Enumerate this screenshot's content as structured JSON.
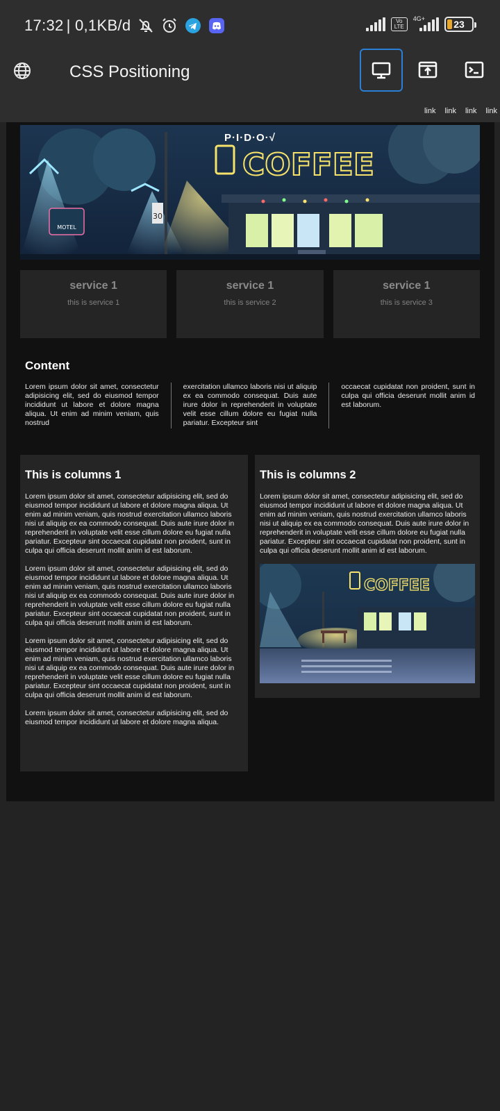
{
  "status_bar": {
    "time": "17:32",
    "net_speed": "| 0,1KB/d",
    "volte": "Vo LTE",
    "network": "4G+",
    "battery": "23",
    "icons": [
      "bell-off-icon",
      "alarm-icon",
      "telegram-icon",
      "discord-icon",
      "signal-icon",
      "battery-icon"
    ]
  },
  "app_bar": {
    "title": "CSS Positioning",
    "buttons": [
      "desktop-preview",
      "open-external",
      "console"
    ],
    "links": [
      "link",
      "link",
      "link",
      "link"
    ]
  },
  "hero": {
    "brand": "P·I·D·O·√",
    "sign_text": "COFFEE",
    "motel_text": "MOTEL",
    "speed_sign": "30"
  },
  "services": [
    {
      "title": "service 1",
      "desc": "this is service 1"
    },
    {
      "title": "service 1",
      "desc": "this is service 2"
    },
    {
      "title": "service 1",
      "desc": "this is service 3"
    }
  ],
  "content": {
    "title": "Content",
    "columns": [
      "Lorem ipsum dolor sit amet, consectetur adipisicing elit, sed do eiusmod tempor incididunt ut labore et dolore magna aliqua. Ut enim ad minim veniam, quis nostrud",
      "exercitation ullamco laboris nisi ut aliquip ex ea commodo consequat. Duis aute irure dolor in reprehenderit in voluptate velit esse cillum dolore eu fugiat nulla pariatur. Excepteur sint",
      "occaecat cupidatat non proident, sunt in culpa qui officia deserunt mollit anim id est laborum."
    ]
  },
  "columns1": {
    "title": "This is columns 1",
    "paragraphs": [
      "Lorem ipsum dolor sit amet, consectetur adipisicing elit, sed do eiusmod tempor incididunt ut labore et dolore magna aliqua. Ut enim ad minim veniam, quis nostrud exercitation ullamco laboris nisi ut aliquip ex ea commodo consequat. Duis aute irure dolor in reprehenderit in voluptate velit esse cillum dolore eu fugiat nulla pariatur. Excepteur sint occaecat cupidatat non proident, sunt in culpa qui officia deserunt mollit anim id est laborum.",
      "Lorem ipsum dolor sit amet, consectetur adipisicing elit, sed do eiusmod tempor incididunt ut labore et dolore magna aliqua. Ut enim ad minim veniam, quis nostrud exercitation ullamco laboris nisi ut aliquip ex ea commodo consequat. Duis aute irure dolor in reprehenderit in voluptate velit esse cillum dolore eu fugiat nulla pariatur. Excepteur sint occaecat cupidatat non proident, sunt in culpa qui officia deserunt mollit anim id est laborum.",
      "Lorem ipsum dolor sit amet, consectetur adipisicing elit, sed do eiusmod tempor incididunt ut labore et dolore magna aliqua. Ut enim ad minim veniam, quis nostrud exercitation ullamco laboris nisi ut aliquip ex ea commodo consequat. Duis aute irure dolor in reprehenderit in voluptate velit esse cillum dolore eu fugiat nulla pariatur. Excepteur sint occaecat cupidatat non proident, sunt in culpa qui officia deserunt mollit anim id est laborum.",
      "Lorem ipsum dolor sit amet, consectetur adipisicing elit, sed do eiusmod tempor incididunt ut labore et dolore magna aliqua."
    ]
  },
  "columns2": {
    "title": "This is columns 2",
    "paragraphs": [
      "Lorem ipsum dolor sit amet, consectetur adipisicing elit, sed do eiusmod tempor incididunt ut labore et dolore magna aliqua. Ut enim ad minim veniam, quis nostrud exercitation ullamco laboris nisi ut aliquip ex ea commodo consequat. Duis aute irure dolor in reprehenderit in voluptate velit esse cillum dolore eu fugiat nulla pariatur. Excepteur sint occaecat cupidatat non proident, sunt in culpa qui officia deserunt mollit anim id est laborum."
    ],
    "image_sign": "COFFEE"
  },
  "colors": {
    "chrome_bg": "#2e2e2e",
    "page_bg": "#111111",
    "card_bg": "#252525",
    "accent_blue": "#2a7fd6",
    "neon_yellow": "#f7e36a"
  }
}
